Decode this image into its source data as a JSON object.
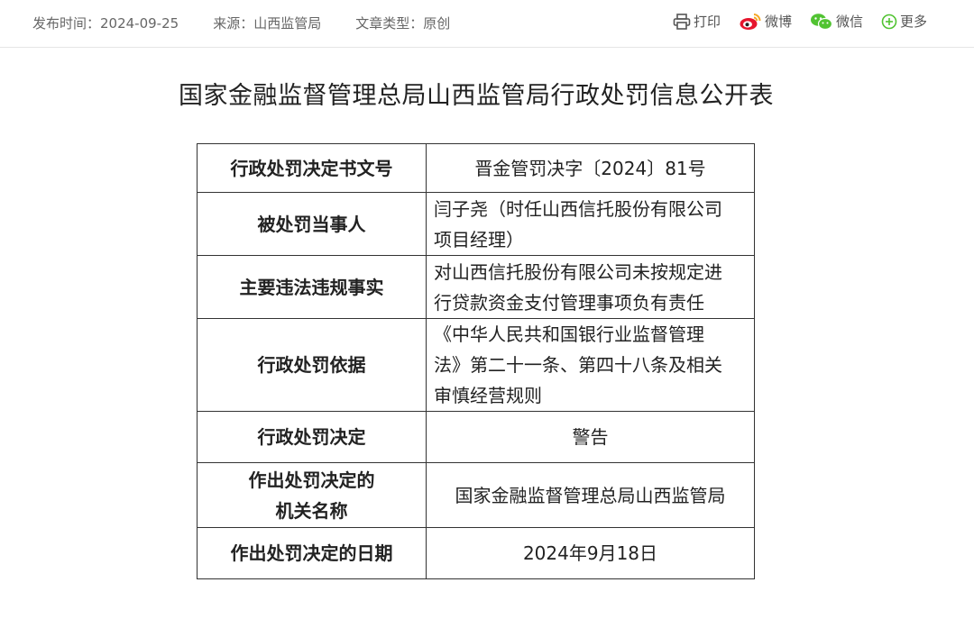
{
  "meta": {
    "publish_time": "发布时间：2024-09-25",
    "source": "来源：山西监管局",
    "article_type": "文章类型：原创"
  },
  "share": {
    "print": "打印",
    "weibo": "微博",
    "wechat": "微信",
    "more": "更多"
  },
  "icons": {
    "print": "printer-icon",
    "weibo": "weibo-icon",
    "wechat": "wechat-icon",
    "more": "plus-circle-icon"
  },
  "colors": {
    "weibo": "#e6162d",
    "weibo_eye": "#f5a623",
    "wechat": "#51c332",
    "more": "#51c332",
    "border": "#333333"
  },
  "title": "国家金融监督管理总局山西监管局行政处罚信息公开表",
  "table": {
    "rows": [
      {
        "label": [
          "行政处罚决定书文号"
        ],
        "value": [
          "晋金管罚决字〔2024〕81号"
        ]
      },
      {
        "label": [
          "被处罚当事人"
        ],
        "value": [
          "闫子尧（时任山西信托股份有限公司",
          "项目经理）"
        ]
      },
      {
        "label": [
          "主要违法违规事实"
        ],
        "value": [
          "对山西信托股份有限公司未按规定进",
          "行贷款资金支付管理事项负有责任"
        ]
      },
      {
        "label": [
          "行政处罚依据"
        ],
        "value": [
          "《中华人民共和国银行业监督管理",
          "法》第二十一条、第四十八条及相关",
          "审慎经营规则"
        ]
      },
      {
        "label": [
          "行政处罚决定"
        ],
        "value": [
          "警告"
        ]
      },
      {
        "label": [
          "作出处罚决定的",
          "机关名称"
        ],
        "value": [
          "国家金融监督管理总局山西监管局"
        ]
      },
      {
        "label": [
          "作出处罚决定的日期"
        ],
        "value": [
          "2024年9月18日"
        ]
      }
    ]
  }
}
